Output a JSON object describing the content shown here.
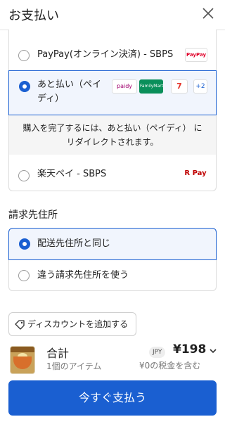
{
  "header": {
    "title": "お支払い"
  },
  "payment": {
    "options": [
      {
        "label": "PayPay(オンライン決済) - SBPS",
        "logo": "PayPay"
      },
      {
        "label_line1": "あと払い（ペイ",
        "label_line2": "ディ）",
        "logos": [
          "paidy",
          "FamilyMart",
          "7"
        ],
        "more": "+2"
      },
      {
        "label": "楽天ペイ - SBPS",
        "logo": "R Pay"
      }
    ],
    "redirect_line1": "購入を完了するには、あと払い（ペイディ） に",
    "redirect_line2": "リダイレクトされます。"
  },
  "billing": {
    "title": "請求先住所",
    "options": [
      "配送先住所と同じ",
      "違う請求先住所を使う"
    ]
  },
  "discount": {
    "label": "ディスカウントを追加する"
  },
  "summary": {
    "title": "合計",
    "items": "1個のアイテム",
    "currency": "JPY",
    "total": "¥198",
    "tax": "¥0の税金を含む"
  },
  "cta": {
    "label": "今すぐ支払う"
  },
  "colors": {
    "accent": "#1a5fd1"
  }
}
